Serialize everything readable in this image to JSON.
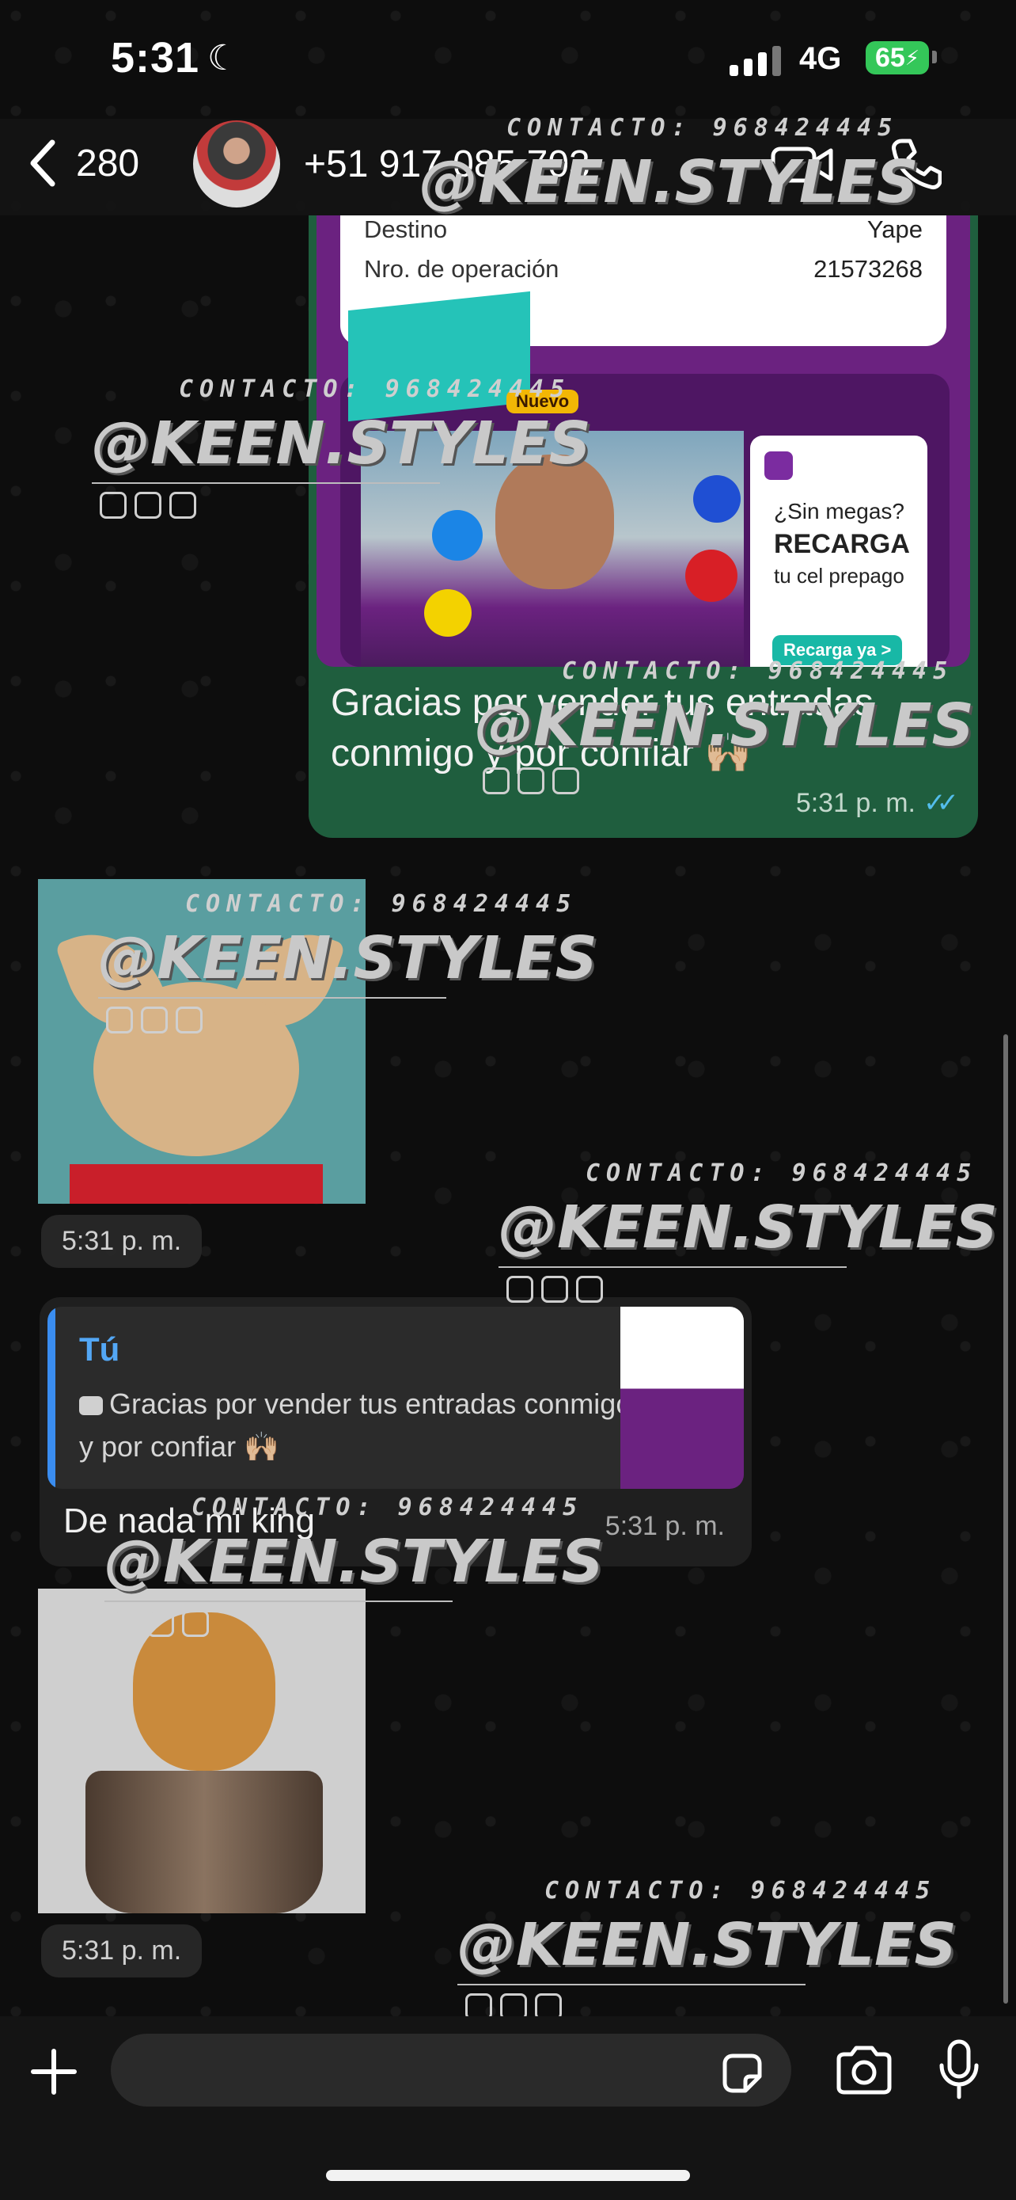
{
  "status_bar": {
    "time": "5:31",
    "network": "4G",
    "battery": "65"
  },
  "header": {
    "back_count": "280",
    "contact": "+51 917 085 703"
  },
  "watermark": {
    "contact": "CONTACTO: 968424445",
    "handle": "@KEEN.STYLES"
  },
  "sent_message": {
    "receipt": {
      "row1_label": "Destino",
      "row1_value": "Yape",
      "row2_label": "Nro. de operación",
      "row2_value": "21573268"
    },
    "promo": {
      "badge": "Nuevo",
      "question": "¿Sin megas?",
      "title": "RECARGA",
      "subtitle": "tu cel prepago",
      "button": "Recarga ya >",
      "logos": [
        "movistar",
        "entel",
        "claro",
        "bitel"
      ]
    },
    "text": "Gracias por vender tus entradas conmigo y por confiar 🙌🏼",
    "time": "5:31 p. m."
  },
  "sticker1": {
    "time": "5:31 p. m."
  },
  "reply_message": {
    "quote_author": "Tú",
    "quote_text": "Gracias por vender tus entradas conmigo y por confiar 🙌🏼",
    "text": "De nada mi king",
    "time": "5:31 p. m."
  },
  "sticker2": {
    "time": "5:31 p. m."
  },
  "input": {
    "placeholder": ""
  },
  "colors": {
    "sent_bubble": "#1f5e3e",
    "accent_blue": "#53a7f5",
    "read_ticks": "#53bdeb",
    "battery": "#34c759"
  }
}
